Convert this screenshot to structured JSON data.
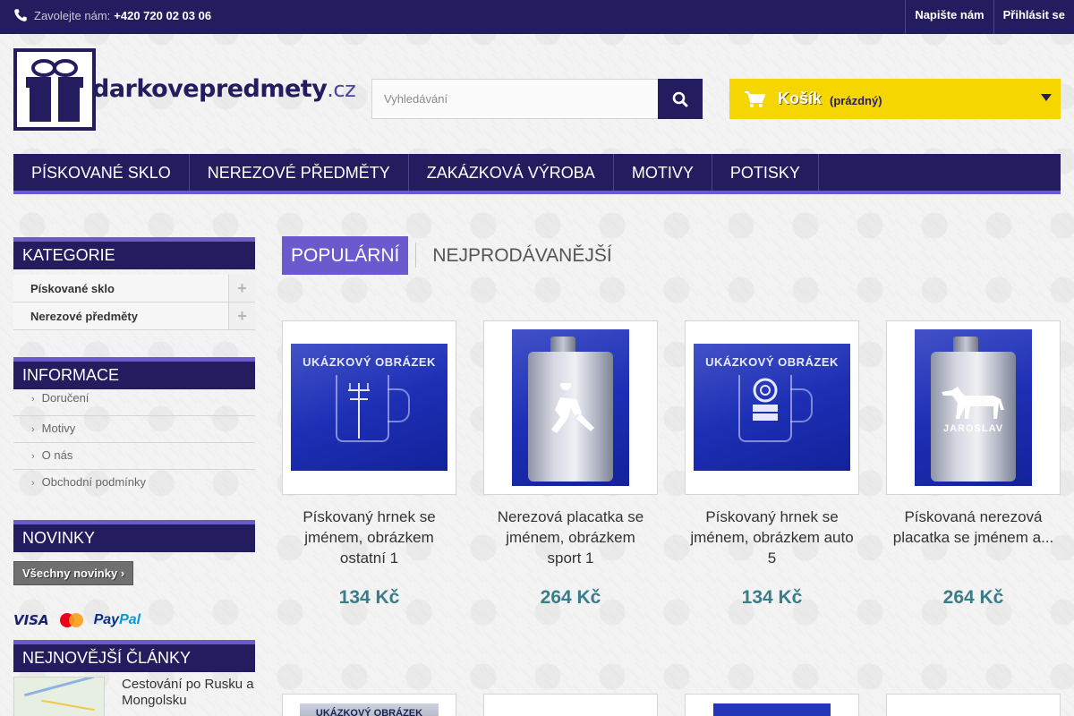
{
  "topbar": {
    "phone_label": "Zavolejte nám:",
    "phone_number": "+420 720 02 03 06",
    "contact_link": "Napište nám",
    "login_link": "Přihlásit se"
  },
  "logo": {
    "name": "darkovepredmety",
    "tld": ".cz"
  },
  "search": {
    "placeholder": "Vyhledávání"
  },
  "cart": {
    "title": "Košík",
    "quantity": "(prázdný)"
  },
  "nav": [
    "Pískované sklo",
    "Nerezové předměty",
    "Zakázková výroba",
    "Motivy",
    "Potisky"
  ],
  "sidebar": {
    "categories": {
      "title": "Kategorie",
      "items": [
        "Pískované sklo",
        "Nerezové předměty"
      ]
    },
    "information": {
      "title": "Informace",
      "items": [
        "Doručení",
        "Motivy",
        "O nás",
        "Obchodní podmínky"
      ]
    },
    "news": {
      "title": "Novinky",
      "button": "Všechny novinky"
    },
    "payments": {
      "visa": "VISA",
      "mastercard": "MasterCard",
      "paypal_a": "Pay",
      "paypal_b": "Pal"
    },
    "articles": {
      "title": "Nejnovější články",
      "items": [
        "Cestování po Rusku a Mongolsku"
      ]
    }
  },
  "tabs": {
    "popular": "Populární",
    "bestsellers": "Nejprodávanější"
  },
  "products": [
    {
      "name": "Pískovaný hrnek se jménem, obrázkem ostatní 1",
      "price": "134 Kč",
      "image_caption": "UKÁZKOVÝ OBRÁZEK"
    },
    {
      "name": "Nerezová placatka se jménem, obrázkem sport 1",
      "price": "264 Kč"
    },
    {
      "name": "Pískovaný hrnek se jménem, obrázkem auto 5",
      "price": "134 Kč",
      "image_caption": "UKÁZKOVÝ OBRÁZEK"
    },
    {
      "name": "Pískovaná nerezová placatka se jménem a...",
      "price": "264 Kč",
      "image_caption": "JAROSLAV"
    }
  ],
  "partial_row": {
    "caption": "UKÁZKOVÝ OBRÁZEK"
  }
}
